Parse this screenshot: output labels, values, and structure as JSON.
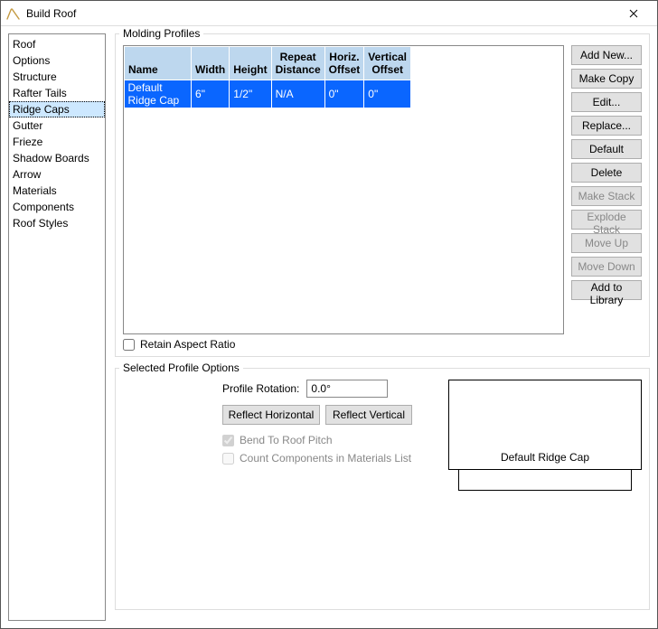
{
  "window": {
    "title": "Build Roof"
  },
  "sidebar": {
    "items": [
      "Roof",
      "Options",
      "Structure",
      "Rafter Tails",
      "Ridge Caps",
      "Gutter",
      "Frieze",
      "Shadow Boards",
      "Arrow",
      "Materials",
      "Components",
      "Roof Styles"
    ],
    "selected_index": 4
  },
  "molding_group": {
    "title": "Molding Profiles",
    "retain_label": "Retain Aspect Ratio",
    "retain_checked": false
  },
  "table": {
    "columns": [
      "Name",
      "Width",
      "Height",
      "Repeat Distance",
      "Horiz. Offset",
      "Vertical Offset"
    ],
    "rows": [
      {
        "name": "Default Ridge Cap",
        "width": "6\"",
        "height": "1/2\"",
        "repeat": "N/A",
        "hoffset": "0\"",
        "voffset": "0\""
      }
    ]
  },
  "buttons": {
    "add_new": "Add New...",
    "make_copy": "Make Copy",
    "edit": "Edit...",
    "replace": "Replace...",
    "default": "Default",
    "delete": "Delete",
    "make_stack": "Make Stack",
    "explode_stack": "Explode Stack",
    "move_up": "Move Up",
    "move_down": "Move Down",
    "add_to_library": "Add to Library"
  },
  "spo": {
    "title": "Selected Profile Options",
    "rotation_label": "Profile Rotation:",
    "rotation_value": "0.0°",
    "reflect_h": "Reflect Horizontal",
    "reflect_v": "Reflect Vertical",
    "bend_label": "Bend To Roof Pitch",
    "bend_checked": true,
    "count_label": "Count Components in Materials List",
    "count_checked": false,
    "preview_label": "Default Ridge Cap"
  }
}
